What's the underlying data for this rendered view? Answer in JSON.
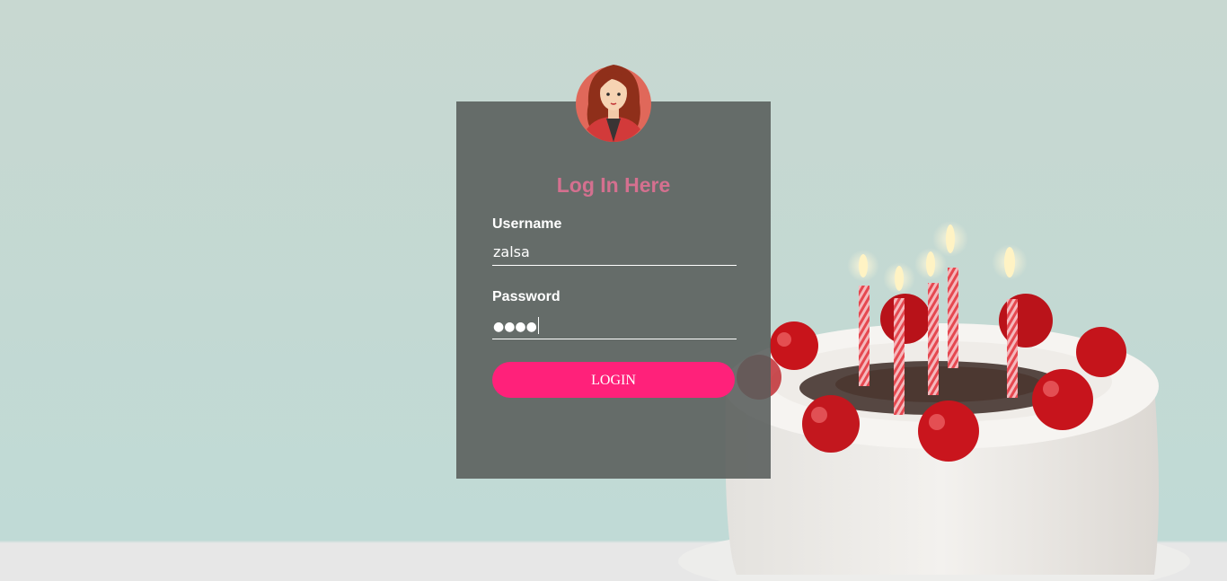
{
  "login": {
    "title": "Log In Here",
    "username_label": "Username",
    "username_value": "zalsa",
    "password_label": "Password",
    "password_masked": "●●●●",
    "login_button": "LOGIN"
  },
  "colors": {
    "title": "#d4708f",
    "button": "#ff217a",
    "panel": "#5d615f"
  },
  "icons": {
    "avatar": "woman-avatar-icon"
  }
}
